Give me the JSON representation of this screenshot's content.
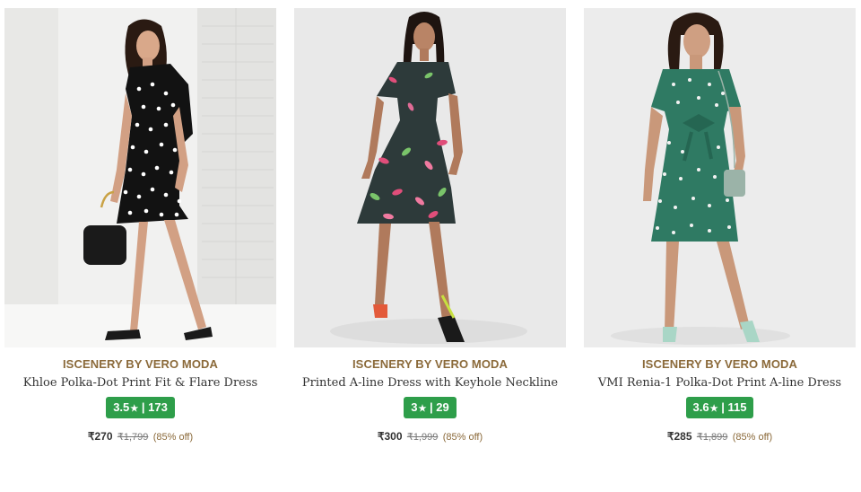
{
  "products": [
    {
      "brand": "ISCENERY BY VERO MODA",
      "name": "Khloe Polka-Dot Print Fit & Flare Dress",
      "rating": "3.5",
      "star": "★",
      "rating_count": "| 173",
      "price": "₹270",
      "mrp": "₹1,799",
      "discount": "(85% off)",
      "image_icon": "model-in-black-polka-dot-dress",
      "dress_color": "#121212"
    },
    {
      "brand": "ISCENERY BY VERO MODA",
      "name": "Printed A-line Dress with Keyhole Neckline",
      "rating": "3",
      "star": "★",
      "rating_count": "| 29",
      "price": "₹300",
      "mrp": "₹1,999",
      "discount": "(85% off)",
      "image_icon": "model-in-printed-a-line-dress",
      "dress_color": "#2d3a3a"
    },
    {
      "brand": "ISCENERY BY VERO MODA",
      "name": "VMI Renia-1 Polka-Dot Print A-line Dress",
      "rating": "3.6",
      "star": "★",
      "rating_count": "| 115",
      "price": "₹285",
      "mrp": "₹1,899",
      "discount": "(85% off)",
      "image_icon": "model-in-green-polka-dot-dress",
      "dress_color": "#2f7a63"
    }
  ],
  "colors": {
    "brand_text": "#8b6a3a",
    "rating_badge": "#2e9e4a"
  }
}
